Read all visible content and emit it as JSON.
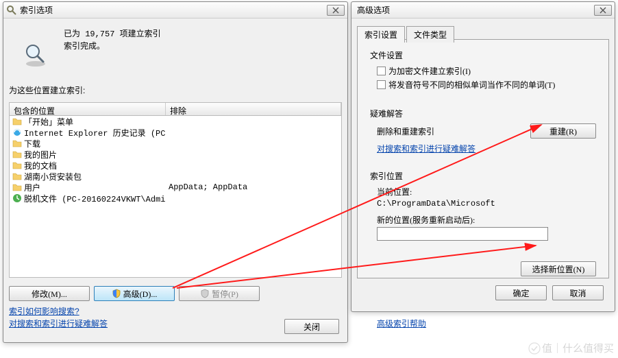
{
  "left": {
    "title": "索引选项",
    "status_count": "已为 19,757 项建立索引",
    "status_done": "索引完成。",
    "locations_label": "为这些位置建立索引:",
    "col_included": "包含的位置",
    "col_excluded": "排除",
    "rows": [
      {
        "icon": "folder",
        "name": "「开始」菜单",
        "excl": ""
      },
      {
        "icon": "ie",
        "name": "Internet Explorer 历史记录 (PC-...",
        "excl": ""
      },
      {
        "icon": "folder",
        "name": "下载",
        "excl": ""
      },
      {
        "icon": "folder",
        "name": "我的图片",
        "excl": ""
      },
      {
        "icon": "folder",
        "name": "我的文档",
        "excl": ""
      },
      {
        "icon": "folder",
        "name": "湖南小贷安装包",
        "excl": ""
      },
      {
        "icon": "folder",
        "name": "用户",
        "excl": "AppData; AppData"
      },
      {
        "icon": "offline",
        "name": "脱机文件 (PC-20160224VKWT\\Admin...",
        "excl": ""
      }
    ],
    "btn_modify": "修改(M)...",
    "btn_advanced": "高级(D)...",
    "btn_pause": "暂停(P)",
    "link_effect": "索引如何影响搜索?",
    "link_trouble": "对搜索和索引进行疑难解答",
    "btn_close": "关闭"
  },
  "right": {
    "title": "高级选项",
    "tab_index": "索引设置",
    "tab_file": "文件类型",
    "grp_file": "文件设置",
    "chk_encrypted": "为加密文件建立索引(I)",
    "chk_diacritic": "将发音符号不同的相似单词当作不同的单词(T)",
    "grp_trouble": "疑难解答",
    "trouble_label": "删除和重建索引",
    "btn_rebuild": "重建(R)",
    "link_trouble": "对搜索和索引进行疑难解答",
    "grp_loc": "索引位置",
    "cur_loc_label": "当前位置:",
    "cur_loc_path": "C:\\ProgramData\\Microsoft",
    "new_loc_label": "新的位置(服务重新启动后):",
    "btn_newloc": "选择新位置(N)",
    "link_advanced": "高级索引帮助",
    "btn_ok": "确定",
    "btn_cancel": "取消"
  },
  "watermark": "值｜什么值得买"
}
